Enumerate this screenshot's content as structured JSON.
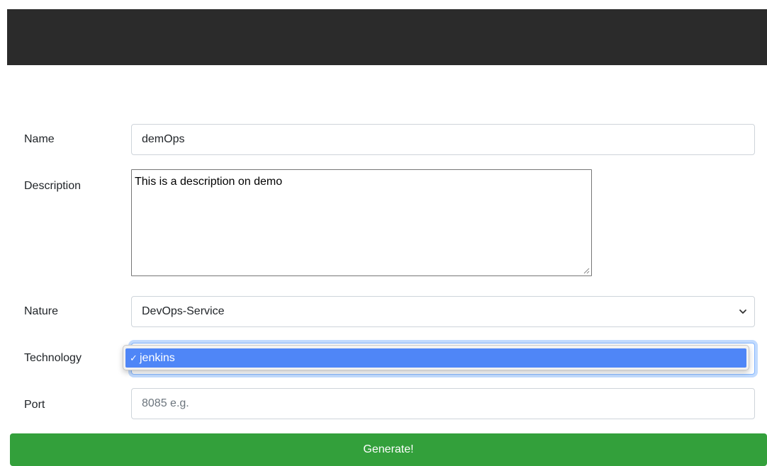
{
  "form": {
    "name": {
      "label": "Name",
      "value": "demOps"
    },
    "description": {
      "label": "Description",
      "value": "This is a description on demo"
    },
    "nature": {
      "label": "Nature",
      "value": "DevOps-Service"
    },
    "technology": {
      "label": "Technology",
      "options": [
        {
          "label": "jenkins",
          "selected": true
        }
      ],
      "check": "✓"
    },
    "port": {
      "label": "Port",
      "placeholder": "8085 e.g."
    },
    "submit_label": "Generate!"
  },
  "colors": {
    "header_bg": "#2b2b2b",
    "generate_button_bg": "#33a03b",
    "dropdown_highlight": "#4f86f7"
  },
  "icons": [
    "chevron-down-icon",
    "resize-grip-icon",
    "checkmark-icon"
  ]
}
